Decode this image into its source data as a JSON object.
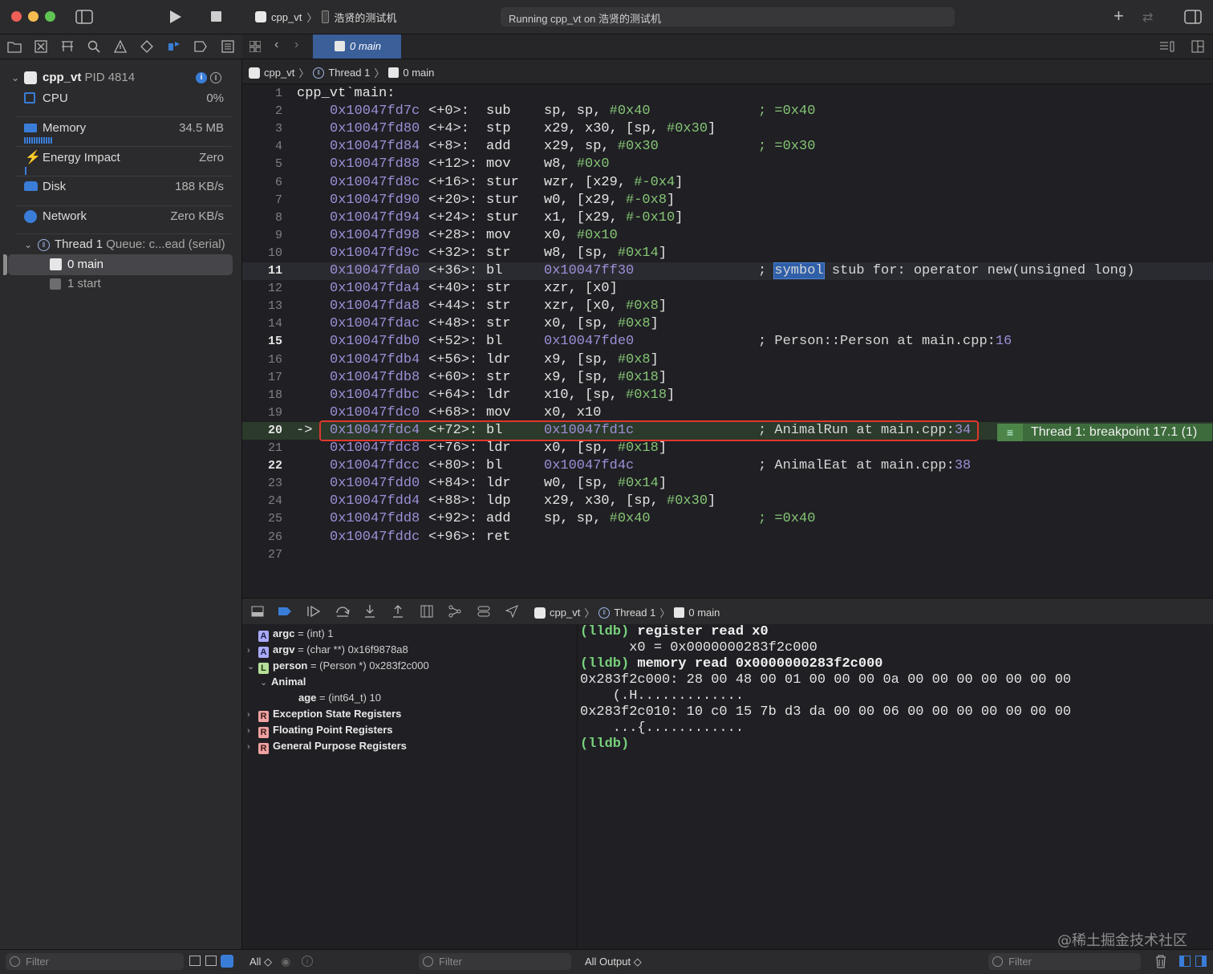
{
  "window": {
    "scheme_target": "cpp_vt",
    "scheme_device": "浩贤的测试机",
    "status_text": "Running cpp_vt on 浩贤的测试机"
  },
  "editor_tab": {
    "label": "0 main"
  },
  "jumpbar": {
    "project": "cpp_vt",
    "thread": "Thread 1",
    "frame": "0 main"
  },
  "debug_navigator": {
    "process_name": "cpp_vt",
    "process_pid": "PID 4814",
    "gauges": [
      {
        "label": "CPU",
        "value": "0%"
      },
      {
        "label": "Memory",
        "value": "34.5 MB"
      },
      {
        "label": "Energy Impact",
        "value": "Zero"
      },
      {
        "label": "Disk",
        "value": "188 KB/s"
      },
      {
        "label": "Network",
        "value": "Zero KB/s"
      }
    ],
    "thread": {
      "name": "Thread 1",
      "queue": "Queue: c...ead (serial)"
    },
    "frames": [
      {
        "label": "0 main",
        "selected": true
      },
      {
        "label": "1 start",
        "selected": false
      }
    ],
    "filter_placeholder": "Filter"
  },
  "disassembly": {
    "header": "cpp_vt`main:",
    "current_line": 20,
    "pc_arrow": "->",
    "lines": [
      {
        "n": 1,
        "bold": false
      },
      {
        "n": 2,
        "bold": false,
        "addr": "0x10047fd7c",
        "off": "<+0>:",
        "mn": "sub",
        "ops": [
          "sp, sp, ",
          "#0x40"
        ],
        "comment": "; =0x40"
      },
      {
        "n": 3,
        "bold": false,
        "addr": "0x10047fd80",
        "off": "<+4>:",
        "mn": "stp",
        "ops": [
          "x29, x30, [sp, ",
          "#0x30",
          "]"
        ]
      },
      {
        "n": 4,
        "bold": false,
        "addr": "0x10047fd84",
        "off": "<+8>:",
        "mn": "add",
        "ops": [
          "x29, sp, ",
          "#0x30"
        ],
        "comment": "; =0x30"
      },
      {
        "n": 5,
        "bold": false,
        "addr": "0x10047fd88",
        "off": "<+12>:",
        "mn": "mov",
        "ops": [
          "w8, ",
          "#0x0"
        ]
      },
      {
        "n": 6,
        "bold": false,
        "addr": "0x10047fd8c",
        "off": "<+16>:",
        "mn": "stur",
        "ops": [
          "wzr, [x29, ",
          "#-0x4",
          "]"
        ]
      },
      {
        "n": 7,
        "bold": false,
        "addr": "0x10047fd90",
        "off": "<+20>:",
        "mn": "stur",
        "ops": [
          "w0, [x29, ",
          "#-0x8",
          "]"
        ]
      },
      {
        "n": 8,
        "bold": false,
        "addr": "0x10047fd94",
        "off": "<+24>:",
        "mn": "stur",
        "ops": [
          "x1, [x29, ",
          "#-0x10",
          "]"
        ]
      },
      {
        "n": 9,
        "bold": false,
        "addr": "0x10047fd98",
        "off": "<+28>:",
        "mn": "mov",
        "ops": [
          "x0, ",
          "#0x10"
        ]
      },
      {
        "n": 10,
        "bold": false,
        "addr": "0x10047fd9c",
        "off": "<+32>:",
        "mn": "str",
        "ops": [
          "w8, [sp, ",
          "#0x14",
          "]"
        ]
      },
      {
        "n": 11,
        "bold": true,
        "addr": "0x10047fda0",
        "off": "<+36>:",
        "mn": "bl",
        "target": "0x10047ff30",
        "comment_pre": "; ",
        "comment_hl": "symbol",
        "comment_post": " stub for: operator new(unsigned long)"
      },
      {
        "n": 12,
        "bold": false,
        "addr": "0x10047fda4",
        "off": "<+40>:",
        "mn": "str",
        "ops": [
          "xzr, [x0]"
        ]
      },
      {
        "n": 13,
        "bold": false,
        "addr": "0x10047fda8",
        "off": "<+44>:",
        "mn": "str",
        "ops": [
          "xzr, [x0, ",
          "#0x8",
          "]"
        ]
      },
      {
        "n": 14,
        "bold": false,
        "addr": "0x10047fdac",
        "off": "<+48>:",
        "mn": "str",
        "ops": [
          "x0, [sp, ",
          "#0x8",
          "]"
        ]
      },
      {
        "n": 15,
        "bold": true,
        "addr": "0x10047fdb0",
        "off": "<+52>:",
        "mn": "bl",
        "target": "0x10047fde0",
        "comment": "; Person::Person at main.cpp:",
        "comment_line": "16"
      },
      {
        "n": 16,
        "bold": false,
        "addr": "0x10047fdb4",
        "off": "<+56>:",
        "mn": "ldr",
        "ops": [
          "x9, [sp, ",
          "#0x8",
          "]"
        ]
      },
      {
        "n": 17,
        "bold": false,
        "addr": "0x10047fdb8",
        "off": "<+60>:",
        "mn": "str",
        "ops": [
          "x9, [sp, ",
          "#0x18",
          "]"
        ]
      },
      {
        "n": 18,
        "bold": false,
        "addr": "0x10047fdbc",
        "off": "<+64>:",
        "mn": "ldr",
        "ops": [
          "x10, [sp, ",
          "#0x18",
          "]"
        ]
      },
      {
        "n": 19,
        "bold": false,
        "addr": "0x10047fdc0",
        "off": "<+68>:",
        "mn": "mov",
        "ops": [
          "x0, x10"
        ]
      },
      {
        "n": 20,
        "bold": true,
        "addr": "0x10047fdc4",
        "off": "<+72>:",
        "mn": "bl",
        "target": "0x10047fd1c",
        "comment": "; AnimalRun at main.cpp:",
        "comment_line": "34"
      },
      {
        "n": 21,
        "bold": false,
        "addr": "0x10047fdc8",
        "off": "<+76>:",
        "mn": "ldr",
        "ops": [
          "x0, [sp, ",
          "#0x18",
          "]"
        ]
      },
      {
        "n": 22,
        "bold": true,
        "addr": "0x10047fdcc",
        "off": "<+80>:",
        "mn": "bl",
        "target": "0x10047fd4c",
        "comment": "; AnimalEat at main.cpp:",
        "comment_line": "38"
      },
      {
        "n": 23,
        "bold": false,
        "addr": "0x10047fdd0",
        "off": "<+84>:",
        "mn": "ldr",
        "ops": [
          "w0, [sp, ",
          "#0x14",
          "]"
        ]
      },
      {
        "n": 24,
        "bold": false,
        "addr": "0x10047fdd4",
        "off": "<+88>:",
        "mn": "ldp",
        "ops": [
          "x29, x30, [sp, ",
          "#0x30",
          "]"
        ]
      },
      {
        "n": 25,
        "bold": false,
        "addr": "0x10047fdd8",
        "off": "<+92>:",
        "mn": "add",
        "ops": [
          "sp, sp, ",
          "#0x40"
        ],
        "comment": "; =0x40"
      },
      {
        "n": 26,
        "bold": false,
        "addr": "0x10047fddc",
        "off": "<+96>:",
        "mn": "ret",
        "ops": []
      },
      {
        "n": 27,
        "bold": false
      }
    ],
    "breakpoint_label": "Thread 1: breakpoint 17.1 (1)"
  },
  "debug_jumpbar": {
    "project": "cpp_vt",
    "thread": "Thread 1",
    "frame": "0 main"
  },
  "variables": [
    {
      "indent": 0,
      "disclosure": "",
      "badge": "A",
      "name": "argc",
      "rest": " = (int) 1"
    },
    {
      "indent": 0,
      "disclosure": ">",
      "badge": "A",
      "name": "argv",
      "rest": " = (char **) 0x16f9878a8"
    },
    {
      "indent": 0,
      "disclosure": "v",
      "badge": "L",
      "name": "person",
      "rest": " = (Person *) 0x283f2c000"
    },
    {
      "indent": 1,
      "disclosure": "v",
      "badge": "",
      "name": "Animal",
      "rest": ""
    },
    {
      "indent": 2,
      "disclosure": "",
      "badge": "",
      "name": "age",
      "rest": " = (int64_t) 10"
    },
    {
      "indent": 0,
      "disclosure": ">",
      "badge": "R",
      "name": "Exception State Registers",
      "rest": ""
    },
    {
      "indent": 0,
      "disclosure": ">",
      "badge": "R",
      "name": "Floating Point Registers",
      "rest": ""
    },
    {
      "indent": 0,
      "disclosure": ">",
      "badge": "R",
      "name": "General Purpose Registers",
      "rest": ""
    }
  ],
  "console": [
    {
      "prompt": "(lldb)",
      "text": " register read x0"
    },
    {
      "prompt": "",
      "text": "      x0 = 0x0000000283f2c000"
    },
    {
      "prompt": "(lldb)",
      "text": " memory read 0x0000000283f2c000"
    },
    {
      "prompt": "",
      "text": "0x283f2c000: 28 00 48 00 01 00 00 00 0a 00 00 00 00 00 00 00"
    },
    {
      "prompt": "",
      "text": "    (.H............."
    },
    {
      "prompt": "",
      "text": "0x283f2c010: 10 c0 15 7b d3 da 00 00 06 00 00 00 00 00 00 00"
    },
    {
      "prompt": "",
      "text": "    ...{............"
    },
    {
      "prompt": "(lldb)",
      "text": ""
    }
  ],
  "bottom": {
    "sidebar_filter": "Filter",
    "vars_scope": "All ◇",
    "vars_filter": "Filter",
    "console_output": "All Output ◇",
    "console_filter": "Filter"
  },
  "watermark": "@稀土掘金技术社区",
  "colors": {
    "accent": "#3a7dd8",
    "highlight_red": "#e0372c",
    "breakpoint_green": "#3d6b3b",
    "lldb_green": "#78d17c"
  }
}
